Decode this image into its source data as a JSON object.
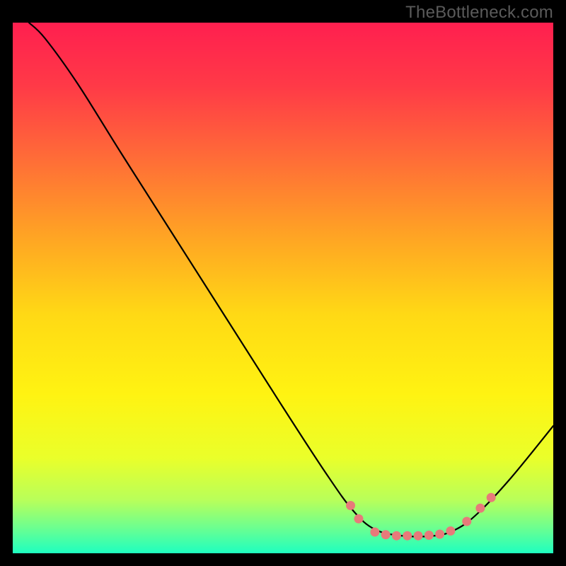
{
  "watermark": "TheBottleneck.com",
  "chart_data": {
    "type": "line",
    "title": "",
    "xlabel": "",
    "ylabel": "",
    "xlim": [
      0,
      100
    ],
    "ylim": [
      0,
      100
    ],
    "background_gradient": {
      "stops": [
        {
          "offset": 0.0,
          "color": "#ff1f4f"
        },
        {
          "offset": 0.12,
          "color": "#ff3a47"
        },
        {
          "offset": 0.25,
          "color": "#ff6a38"
        },
        {
          "offset": 0.4,
          "color": "#ffa324"
        },
        {
          "offset": 0.55,
          "color": "#ffd915"
        },
        {
          "offset": 0.7,
          "color": "#fff312"
        },
        {
          "offset": 0.82,
          "color": "#eaff2a"
        },
        {
          "offset": 0.9,
          "color": "#b8ff5a"
        },
        {
          "offset": 0.95,
          "color": "#6fff8e"
        },
        {
          "offset": 1.0,
          "color": "#1effc0"
        }
      ]
    },
    "series": [
      {
        "name": "bottleneck-curve",
        "color": "#000000",
        "points": [
          {
            "x": 3.0,
            "y": 100.0
          },
          {
            "x": 6.0,
            "y": 97.0
          },
          {
            "x": 12.0,
            "y": 88.5
          },
          {
            "x": 20.0,
            "y": 75.5
          },
          {
            "x": 30.0,
            "y": 59.5
          },
          {
            "x": 40.0,
            "y": 43.5
          },
          {
            "x": 50.0,
            "y": 27.5
          },
          {
            "x": 58.0,
            "y": 15.0
          },
          {
            "x": 63.0,
            "y": 8.0
          },
          {
            "x": 67.0,
            "y": 4.5
          },
          {
            "x": 72.0,
            "y": 3.3
          },
          {
            "x": 78.0,
            "y": 3.3
          },
          {
            "x": 82.0,
            "y": 4.5
          },
          {
            "x": 86.0,
            "y": 7.5
          },
          {
            "x": 92.0,
            "y": 14.0
          },
          {
            "x": 100.0,
            "y": 24.0
          }
        ]
      }
    ],
    "scatter": {
      "name": "highlight-points",
      "color": "#e77a7a",
      "radius": 6.5,
      "points": [
        {
          "x": 62.5,
          "y": 9.0
        },
        {
          "x": 64.0,
          "y": 6.5
        },
        {
          "x": 67.0,
          "y": 4.0
        },
        {
          "x": 69.0,
          "y": 3.5
        },
        {
          "x": 71.0,
          "y": 3.3
        },
        {
          "x": 73.0,
          "y": 3.3
        },
        {
          "x": 75.0,
          "y": 3.3
        },
        {
          "x": 77.0,
          "y": 3.4
        },
        {
          "x": 79.0,
          "y": 3.6
        },
        {
          "x": 81.0,
          "y": 4.2
        },
        {
          "x": 84.0,
          "y": 6.0
        },
        {
          "x": 86.5,
          "y": 8.5
        },
        {
          "x": 88.5,
          "y": 10.5
        }
      ]
    }
  }
}
